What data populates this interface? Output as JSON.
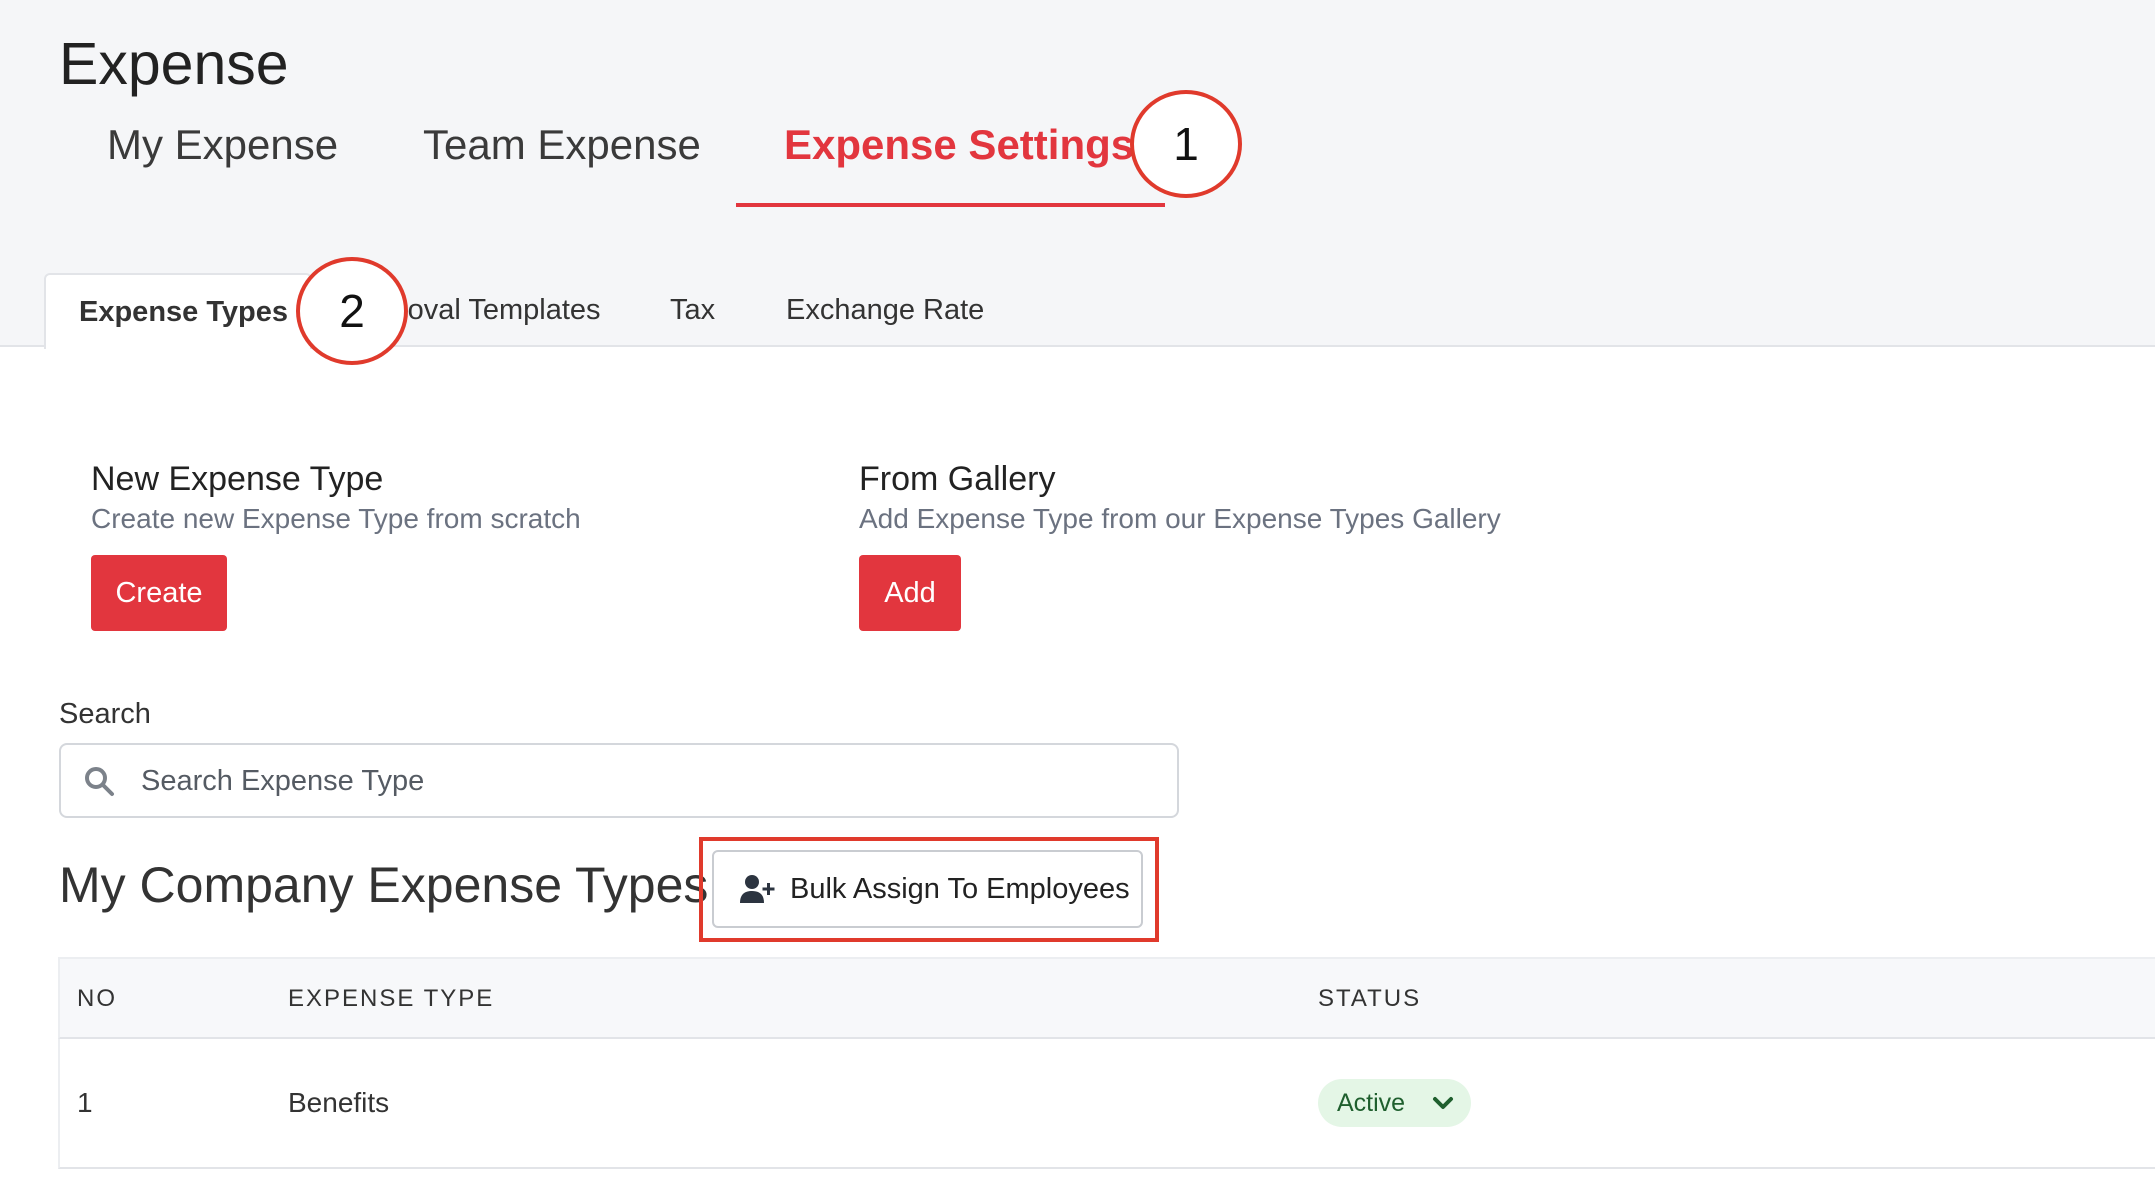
{
  "page": {
    "title": "Expense"
  },
  "main_tabs": [
    {
      "label": "My Expense"
    },
    {
      "label": "Team Expense"
    },
    {
      "label": "Expense Settings",
      "active": true
    }
  ],
  "sub_tabs": [
    {
      "label": "Expense Types",
      "active": true
    },
    {
      "label": "roval Templates"
    },
    {
      "label": "Tax"
    },
    {
      "label": "Exchange Rate"
    }
  ],
  "callouts": {
    "first": "1",
    "second": "2"
  },
  "new_expense": {
    "title": "New Expense Type",
    "description": "Create new Expense Type from scratch",
    "button": "Create"
  },
  "gallery": {
    "title": "From Gallery",
    "description": "Add Expense Type from our Expense Types Gallery",
    "button": "Add"
  },
  "search": {
    "label": "Search",
    "placeholder": "Search Expense Type",
    "value": ""
  },
  "list": {
    "title": "My Company Expense Types",
    "bulk_button": "Bulk Assign To Employees"
  },
  "table": {
    "columns": [
      "NO",
      "EXPENSE TYPE",
      "STATUS"
    ],
    "rows": [
      {
        "no": "1",
        "expense_type": "Benefits",
        "status": "Active"
      }
    ]
  },
  "colors": {
    "accent": "#e2363e",
    "callout": "#e03a2c",
    "status_active_bg": "#e4f6e6",
    "status_active_text": "#1f5f2e"
  },
  "icons": {
    "search": "search-icon",
    "bulk": "user-plus-icon",
    "status_toggle": "chevron-down-icon"
  }
}
